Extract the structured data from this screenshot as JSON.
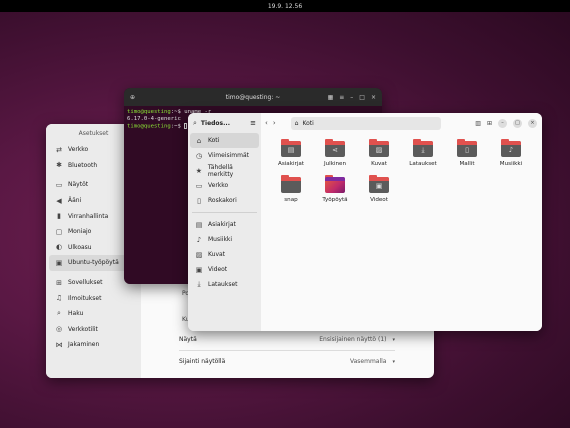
{
  "topbar": {
    "clock": "19.9. 12.56"
  },
  "settings": {
    "title": "Asetukset",
    "items": [
      {
        "label": "Verkko",
        "icon": "network-icon"
      },
      {
        "label": "Bluetooth",
        "icon": "bluetooth-icon"
      },
      {
        "label": "Näytöt",
        "icon": "display-icon"
      },
      {
        "label": "Ääni",
        "icon": "sound-icon"
      },
      {
        "label": "Virranhallinta",
        "icon": "power-icon"
      },
      {
        "label": "Moniajo",
        "icon": "multitasking-icon"
      },
      {
        "label": "Ulkoasu",
        "icon": "appearance-icon"
      },
      {
        "label": "Ubuntu-työpöytä",
        "icon": "ubuntu-desktop-icon"
      },
      {
        "label": "Sovellukset",
        "icon": "apps-icon"
      },
      {
        "label": "Ilmoitukset",
        "icon": "bell-icon"
      },
      {
        "label": "Haku",
        "icon": "search-icon"
      },
      {
        "label": "Verkkotilit",
        "icon": "online-accounts-icon"
      },
      {
        "label": "Jakaminen",
        "icon": "sharing-icon"
      }
    ],
    "clipped_label_1": "Po",
    "clipped_label_2": "Ku",
    "rows": [
      {
        "label": "Näytä",
        "value": "Ensisijainen näyttö (1)"
      },
      {
        "label": "Sijainti näytöllä",
        "value": "Vasemmalla"
      }
    ]
  },
  "terminal": {
    "title": "timo@questing: ~",
    "line1_prompt": "timo@questing",
    "line1_rest": ":~$ uname -r",
    "line2": "6.17.0-4-generic",
    "line3_prompt": "timo@questing",
    "line3_rest": ":~$ "
  },
  "files": {
    "app_title": "Tiedos...",
    "path": "Koti",
    "sidebar": [
      {
        "label": "Koti",
        "icon": "home-icon"
      },
      {
        "label": "Viimeisimmät",
        "icon": "recent-icon"
      },
      {
        "label": "Tähdellä merkitty",
        "icon": "star-icon"
      },
      {
        "label": "Verkko",
        "icon": "network-icon"
      },
      {
        "label": "Roskakori",
        "icon": "trash-icon"
      },
      {
        "label": "Asiakirjat",
        "icon": "documents-icon"
      },
      {
        "label": "Musiikki",
        "icon": "music-icon"
      },
      {
        "label": "Kuvat",
        "icon": "pictures-icon"
      },
      {
        "label": "Videot",
        "icon": "videos-icon"
      },
      {
        "label": "Lataukset",
        "icon": "downloads-icon"
      }
    ],
    "folders": [
      {
        "label": "Asiakirjat",
        "icon": "documents-folder-icon"
      },
      {
        "label": "Julkinen",
        "icon": "public-folder-icon"
      },
      {
        "label": "Kuvat",
        "icon": "pictures-folder-icon"
      },
      {
        "label": "Lataukset",
        "icon": "downloads-folder-icon"
      },
      {
        "label": "Mallit",
        "icon": "templates-folder-icon"
      },
      {
        "label": "Musiikki",
        "icon": "music-folder-icon"
      },
      {
        "label": "snap",
        "icon": "folder-icon"
      },
      {
        "label": "Työpöytä",
        "icon": "desktop-folder-icon"
      },
      {
        "label": "Videot",
        "icon": "videos-folder-icon"
      }
    ]
  }
}
